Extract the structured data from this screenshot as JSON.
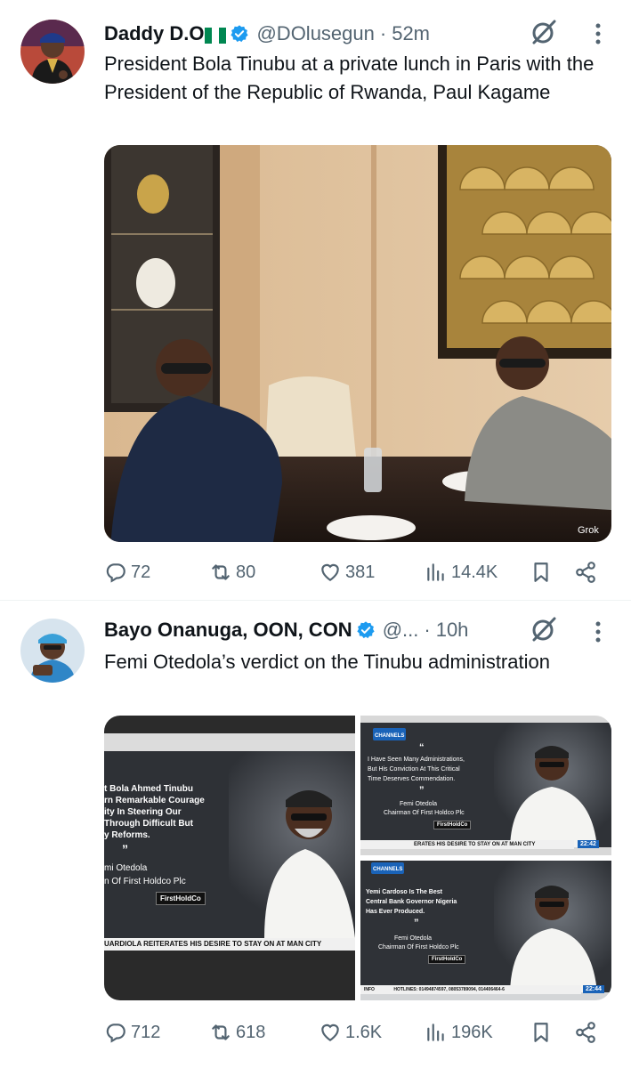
{
  "tweets": [
    {
      "name": "Daddy D.O",
      "handle": "@DOlusegun",
      "separator": "·",
      "time": "52m",
      "text": "President Bola Tinubu at a private lunch in Paris with the President of the Republic of Rwanda, Paul Kagame",
      "image_watermark": "Grok",
      "stats": {
        "replies": "72",
        "reposts": "80",
        "likes": "381",
        "views": "14.4K"
      }
    },
    {
      "name": "Bayo Onanuga, OON, CON",
      "handle": "@...",
      "separator": "·",
      "time": "10h",
      "text": "Femi Otedola’s verdict on the Tinubu administration",
      "tv_left": {
        "lines": [
          "t Bola Ahmed Tinubu",
          "rn Remarkable Courage",
          "ity In Steering Our",
          "Through Difficult But",
          "y Reforms."
        ],
        "quote_mark": "”",
        "speaker": "mi Otedola",
        "role": "n Of First Holdco Plc",
        "logo": "FirstHoldCo",
        "ticker": "UARDIOLA REITERATES HIS DESIRE TO STAY ON AT MAN CITY"
      },
      "tv_top_right": {
        "channel": "CHANNELS",
        "quote_open": "“",
        "lines": [
          "I Have Seen Many Administrations,",
          "But His Conviction At This Critical",
          "Time Deserves Commendation."
        ],
        "quote_close": "”",
        "speaker": "Femi Otedola",
        "role": "Chairman Of First Holdco Plc",
        "logo": "FirstHoldCo",
        "ticker": "ERATES HIS DESIRE TO STAY ON AT MAN CITY",
        "clock": "22:42"
      },
      "tv_bottom_right": {
        "channel": "CHANNELS",
        "lines": [
          "Yemi Cardoso Is The Best",
          "Central Bank Governor Nigeria",
          "Has Ever Produced."
        ],
        "quote_close": "”",
        "speaker": "Femi Otedola",
        "role": "Chairman Of First Holdco Plc",
        "logo": "FirstHoldCo",
        "info": "INFO",
        "ticker": "HOTLINES: 01494874597, 08053789094, 014406464-6",
        "clock": "22:44"
      },
      "stats": {
        "replies": "712",
        "reposts": "618",
        "likes": "1.6K",
        "views": "196K"
      }
    }
  ],
  "colors": {
    "text": "#0f1419",
    "secondary": "#536471",
    "verified": "#1d9bf0",
    "divider": "#eff3f4",
    "nigeria_green": "#008751"
  }
}
